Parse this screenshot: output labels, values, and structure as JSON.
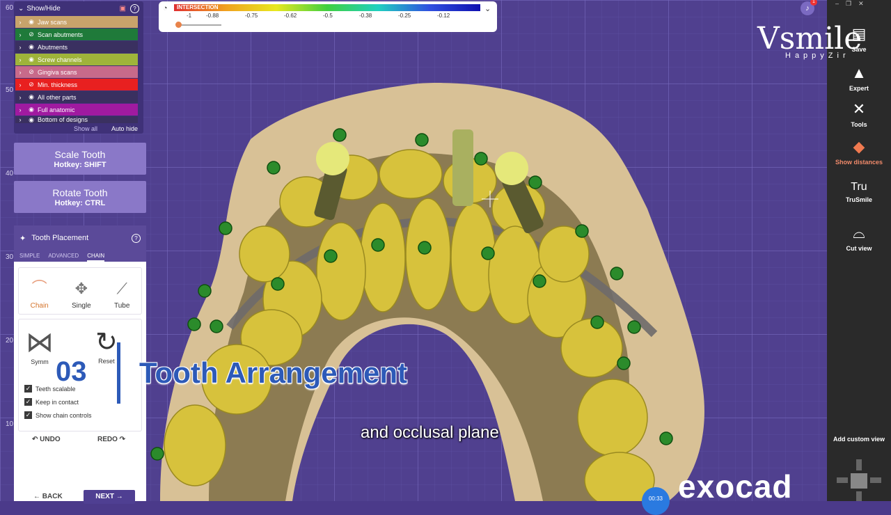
{
  "ruler": {
    "labels": [
      "60",
      "50",
      "40",
      "30",
      "20",
      "10"
    ]
  },
  "show_hide": {
    "title": "Show/Hide",
    "rows": [
      {
        "label": "Jaw scans",
        "color": "#c8a36b",
        "eye": "visible"
      },
      {
        "label": "Scan abutments",
        "color": "#1f7a3a",
        "eye": "hidden"
      },
      {
        "label": "Abutments",
        "color": "#3a3060",
        "eye": "visible"
      },
      {
        "label": "Screw channels",
        "color": "#9fb43a",
        "eye": "visible"
      },
      {
        "label": "Gingiva scans",
        "color": "#c86a8a",
        "eye": "hidden"
      },
      {
        "label": "Min. thickness",
        "color": "#e82020",
        "eye": "hidden"
      },
      {
        "label": "All other parts",
        "color": "#3a3060",
        "eye": "visible"
      },
      {
        "label": "Full anatomic",
        "color": "#a01aa0",
        "eye": "visible"
      },
      {
        "label": "Bottom of designs",
        "color": "#3a3060",
        "eye": "visible"
      }
    ],
    "show_all": "Show all",
    "auto_hide": "Auto hide"
  },
  "scale_tooth": {
    "label": "Scale Tooth",
    "hotkey": "Hotkey: SHIFT"
  },
  "rotate_tooth": {
    "label": "Rotate Tooth",
    "hotkey": "Hotkey: CTRL"
  },
  "tooth_placement": {
    "title": "Tooth Placement",
    "tabs": [
      "SIMPLE",
      "ADVANCED",
      "CHAIN"
    ],
    "active_tab": "CHAIN",
    "modes": [
      "Chain",
      "Single",
      "Tube"
    ],
    "active_mode": "Chain",
    "symm_label": "Symm",
    "reset_label": "Reset",
    "checkboxes": [
      "Teeth scalable",
      "Keep in contact",
      "Show chain controls"
    ],
    "undo": "UNDO",
    "redo": "REDO",
    "back": "BACK",
    "next": "NEXT"
  },
  "colorbar": {
    "label": "INTERSECTION",
    "ticks": [
      "-1",
      "-0.88",
      "-0.75",
      "-0.62",
      "-0.5",
      "-0.38",
      "-0.25",
      "-0.12"
    ]
  },
  "right_toolbar": {
    "items": [
      {
        "label": "Save",
        "icon": "save-icon"
      },
      {
        "label": "Expert",
        "icon": "graduation-cap-icon"
      },
      {
        "label": "Tools",
        "icon": "tools-icon"
      },
      {
        "label": "Show distances",
        "icon": "distances-icon",
        "active": true
      },
      {
        "label": "TruSmile",
        "icon": "trusmile-icon"
      },
      {
        "label": "Cut view",
        "icon": "cut-view-icon"
      },
      {
        "label": "Add custom view",
        "icon": ""
      }
    ],
    "notification_count": "1"
  },
  "overlay": {
    "number": "03",
    "title": "Tooth Arrangement",
    "subtitle": "and occlusal plane",
    "timer": "00:33"
  },
  "logos": {
    "vsmile": "Vsmile",
    "happyzir": "HappyZir",
    "exocad": "exocad"
  }
}
